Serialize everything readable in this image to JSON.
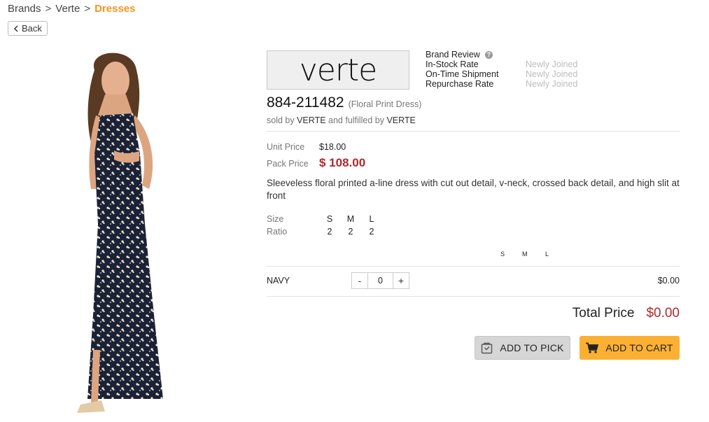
{
  "breadcrumb": {
    "items": [
      "Brands",
      "Verte"
    ],
    "current": "Dresses",
    "separator": ">"
  },
  "back_button": {
    "label": "Back",
    "icon": "chevron-left-icon"
  },
  "brand": {
    "logo_text": "verte",
    "review_label": "Brand Review",
    "review_help_icon": "help-circle-icon",
    "metrics": [
      {
        "label": "In-Stock Rate",
        "value": "Newly Joined"
      },
      {
        "label": "On-Time Shipment",
        "value": "Newly Joined"
      },
      {
        "label": "Repurchase Rate",
        "value": "Newly Joined"
      }
    ]
  },
  "product": {
    "sku": "884-211482",
    "name": "(Floral Print Dress)",
    "sold_by_prefix": "sold by",
    "seller": "VERTE",
    "fulfilled_by_text": "and fulfilled by",
    "fulfiller": "VERTE",
    "unit_price_label": "Unit Price",
    "unit_price": "$18.00",
    "pack_price_label": "Pack Price",
    "pack_price": "$ 108.00",
    "description": "Sleeveless floral printed a-line dress with cut out detail, v-neck, crossed back detail, and high slit at front",
    "size_label": "Size",
    "ratio_label": "Ratio",
    "sizes": [
      "S",
      "M",
      "L"
    ],
    "ratios": [
      "2",
      "2",
      "2"
    ],
    "image_alt": "model-wearing-navy-floral-maxi-dress"
  },
  "order": {
    "size_headers": [
      "S",
      "M",
      "L"
    ],
    "colors": [
      {
        "name": "NAVY",
        "quantity": "0",
        "minus": "-",
        "plus": "+",
        "line_total": "$0.00"
      }
    ],
    "total_label": "Total Price",
    "total_value": "$0.00"
  },
  "actions": {
    "add_to_pick_label": "ADD TO PICK",
    "add_to_pick_icon": "pick-bag-icon",
    "add_to_cart_label": "ADD TO CART",
    "add_to_cart_icon": "shopping-cart-icon"
  },
  "colors": {
    "breadcrumb_active": "#f7941d",
    "price_red": "#b0282d",
    "cart_button": "#fbb034",
    "pick_button": "#d6d6d6",
    "muted_text": "#bdbdbd"
  }
}
